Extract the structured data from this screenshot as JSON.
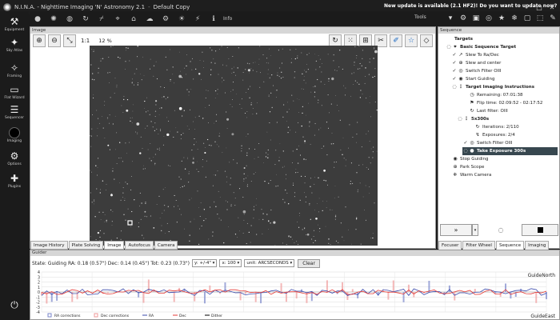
{
  "window": {
    "title": "N.I.N.A. - Nighttime Imaging 'N' Astronomy 2.1",
    "profile": "Default Copy",
    "update_notice": "New update is available (2.1 HF2)! Do you want to update now?"
  },
  "toolbar": {
    "info_label": "Info",
    "tools_label": "Tools",
    "left_icons": [
      "camera-icon",
      "filter-wheel-icon",
      "focuser-icon",
      "rotator-icon",
      "telescope-icon",
      "guider-icon",
      "dome-icon",
      "weather-icon",
      "switch-icon",
      "flat-panel-icon",
      "safety-monitor-icon"
    ],
    "right_icons": [
      "tools-chevron-icon",
      "settings-icon",
      "focus-icon",
      "polar-icon",
      "star-icon",
      "snowflake-icon",
      "frame-icon",
      "bookmark-icon",
      "tool-icon"
    ]
  },
  "sidebar": {
    "items": [
      {
        "label": "Equipment",
        "icon": "equipment-icon"
      },
      {
        "label": "Sky Atlas",
        "icon": "sky-atlas-icon"
      },
      {
        "label": "Framing",
        "icon": "framing-icon"
      },
      {
        "label": "Flat Wizard",
        "icon": "flat-wizard-icon"
      },
      {
        "label": "Sequencer",
        "icon": "sequencer-icon"
      },
      {
        "label": "Imaging",
        "icon": "imaging-icon"
      },
      {
        "label": "Options",
        "icon": "options-icon"
      },
      {
        "label": "Plugins",
        "icon": "plugins-icon"
      }
    ],
    "power_icon": "power-icon"
  },
  "image_panel": {
    "title": "Image",
    "one_to_one": "1:1",
    "zoom": "12 %",
    "tabs": [
      "Image History",
      "Plate Solving",
      "Image",
      "Autofocus",
      "Camera"
    ],
    "active_tab": "Image"
  },
  "sequence_panel": {
    "title": "Sequence",
    "rows": [
      {
        "text": "Targets",
        "indent": 0,
        "bold": true,
        "marker": "",
        "icon": ""
      },
      {
        "text": "Basic Sequence Target",
        "indent": 1,
        "bold": true,
        "marker": "◌",
        "icon": "⌖"
      },
      {
        "text": "Slew To Ra/Dec",
        "indent": 2,
        "bold": false,
        "marker": "✓",
        "icon": "↗"
      },
      {
        "text": "Slew and center",
        "indent": 2,
        "bold": false,
        "marker": "✓",
        "icon": "⊕"
      },
      {
        "text": "Switch Filter OIII",
        "indent": 2,
        "bold": false,
        "marker": "✓",
        "icon": "◎"
      },
      {
        "text": "Start Guiding",
        "indent": 2,
        "bold": false,
        "marker": "✓",
        "icon": "◉"
      },
      {
        "text": "Target Imaging Instructions",
        "indent": 2,
        "bold": true,
        "marker": "◌",
        "icon": "⋮"
      },
      {
        "text": "Remaining: 07:01:38",
        "indent": 4,
        "bold": false,
        "marker": "",
        "icon": "◷"
      },
      {
        "text": "Flip time: 02:09:52 - 02:17:52",
        "indent": 4,
        "bold": false,
        "marker": "",
        "icon": "⚑"
      },
      {
        "text": "Last filter: OIII",
        "indent": 4,
        "bold": false,
        "marker": "",
        "icon": "↻"
      },
      {
        "text": "5x300s",
        "indent": 3,
        "bold": true,
        "marker": "◌",
        "icon": "⋮"
      },
      {
        "text": "Iterations: 2/110",
        "indent": 5,
        "bold": false,
        "marker": "",
        "icon": "↻"
      },
      {
        "text": "Exposures: 2/4",
        "indent": 5,
        "bold": false,
        "marker": "",
        "icon": "↯"
      },
      {
        "text": "Switch Filter OIII",
        "indent": 4,
        "bold": false,
        "marker": "✓",
        "icon": "◎"
      },
      {
        "text": "Take Exposure 300s",
        "indent": 4,
        "bold": true,
        "marker": "◌",
        "icon": "●",
        "selected": true
      },
      {
        "text": "Stop Guiding",
        "indent": 1,
        "bold": false,
        "marker": "",
        "icon": "◉"
      },
      {
        "text": "Park Scope",
        "indent": 1,
        "bold": false,
        "marker": "",
        "icon": "⊕"
      },
      {
        "text": "Warm Camera",
        "indent": 1,
        "bold": false,
        "marker": "",
        "icon": "❄"
      }
    ],
    "tabs": [
      "Focuser",
      "Filter Wheel",
      "Sequence",
      "Imaging"
    ],
    "active_tab": "Sequence"
  },
  "guider_panel": {
    "title": "Guider",
    "state": "State: Guiding",
    "ra": "RA: 0.18 (0.57\")",
    "dec": "Dec: 0.14 (0.45\")",
    "tot": "Tot: 0.23 (0.73\")",
    "y_scale": "y: +/-4\"",
    "x_count": "x: 100",
    "unit": "unit: ARCSECONDS",
    "clear_label": "Clear",
    "north_label": "GuideNorth",
    "east_label": "GuideEast",
    "legend": [
      "RA corrections",
      "Dec corrections",
      "RA",
      "Dec",
      "Dither"
    ],
    "y_ticks": [
      "4",
      "3",
      "2",
      "1",
      "0",
      "-1",
      "-2",
      "-3",
      "-4"
    ]
  },
  "colors": {
    "ra": "#3949ab",
    "dec": "#e53935",
    "ra_corr": "#7986cb",
    "dec_corr": "#ef9a9a",
    "selected_row": "#37474f"
  }
}
